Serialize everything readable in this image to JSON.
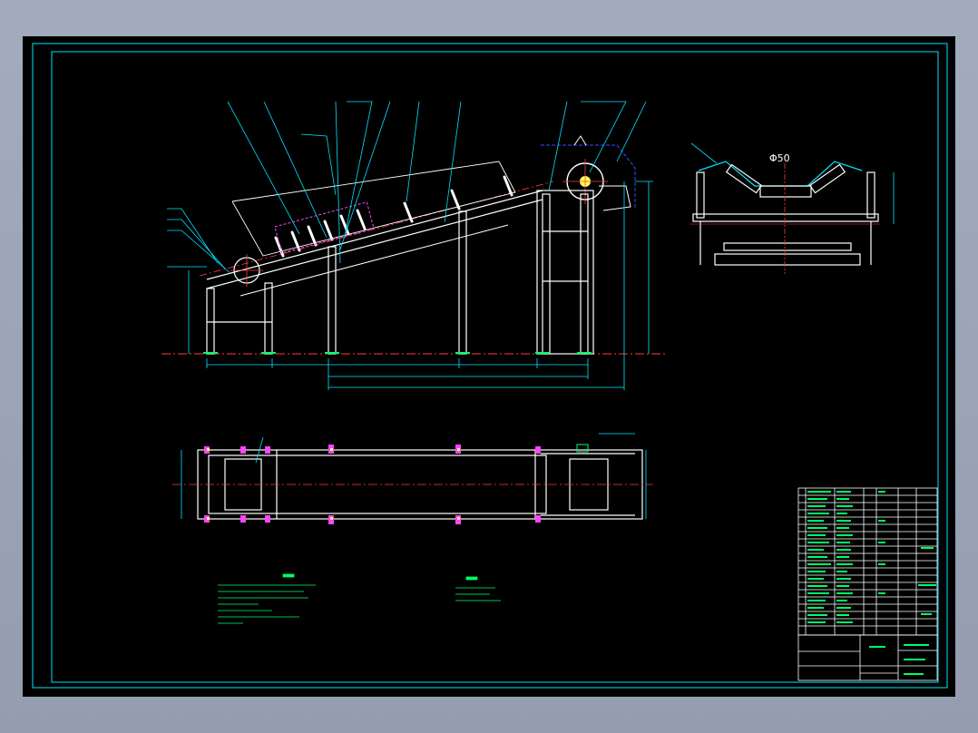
{
  "colors": {
    "background": "#000000",
    "frame": "#00e5ff",
    "geometry": "#ffffff",
    "centerline": "#ff3b3b",
    "dimension": "#00e5ff",
    "text": "#00ff66",
    "hidden": "#3b4bff",
    "accent": "#ff44ff",
    "viewer": "#9aa4b5"
  },
  "side_view": {
    "diameter_label": "Φ50"
  }
}
